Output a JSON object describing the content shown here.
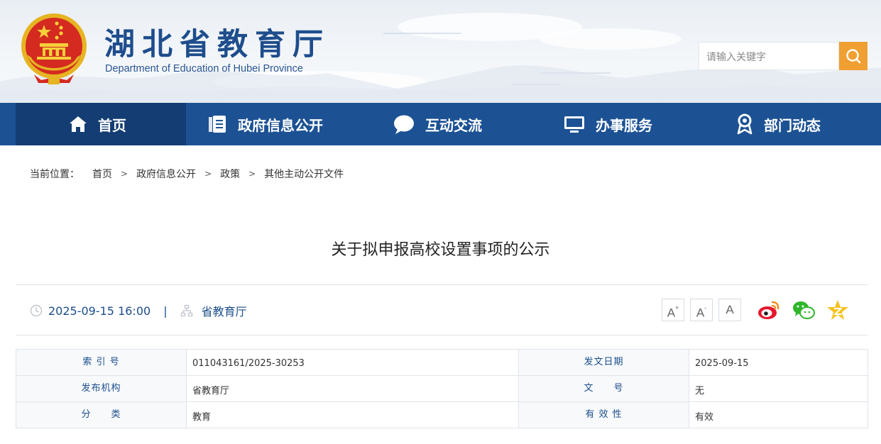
{
  "header": {
    "site_title": "湖北省教育厅",
    "site_subtitle": "Department of Education of Hubei Province",
    "search_placeholder": "请输入关键字"
  },
  "nav": {
    "items": [
      {
        "label": "首页",
        "icon": "home-icon",
        "active": true
      },
      {
        "label": "政府信息公开",
        "icon": "document-icon",
        "active": false
      },
      {
        "label": "互动交流",
        "icon": "chat-bubble-icon",
        "active": false
      },
      {
        "label": "办事服务",
        "icon": "monitor-icon",
        "active": false
      },
      {
        "label": "部门动态",
        "icon": "location-pin-icon",
        "active": false
      }
    ]
  },
  "breadcrumb": {
    "prefix": "当前位置：",
    "items": [
      "首页",
      "政府信息公开",
      "政策",
      "其他主动公开文件"
    ],
    "separator": ">"
  },
  "article": {
    "title": "关于拟申报高校设置事项的公示",
    "datetime": "2025-09-15 16:00",
    "divider": "|",
    "source": "省教育厅",
    "font_sizes": [
      "A+",
      "A-",
      "A"
    ]
  },
  "share": [
    "weibo-icon",
    "wechat-icon",
    "qzone-icon"
  ],
  "info_table": {
    "rows": [
      {
        "k1": "索 引 号",
        "v1": "011043161/2025-30253",
        "k2": "发文日期",
        "v2": "2025-09-15"
      },
      {
        "k1": "发布机构",
        "v1": "省教育厅",
        "k2": "文　　号",
        "v2": "无"
      },
      {
        "k1": "分　　类",
        "v1": "教育",
        "k2": "有 效 性",
        "v2": "有效"
      }
    ]
  },
  "colors": {
    "brand_blue": "#1c5294",
    "nav_active": "#133d73",
    "search_button": "#f0a032",
    "title_blue": "#1e4d8c"
  }
}
